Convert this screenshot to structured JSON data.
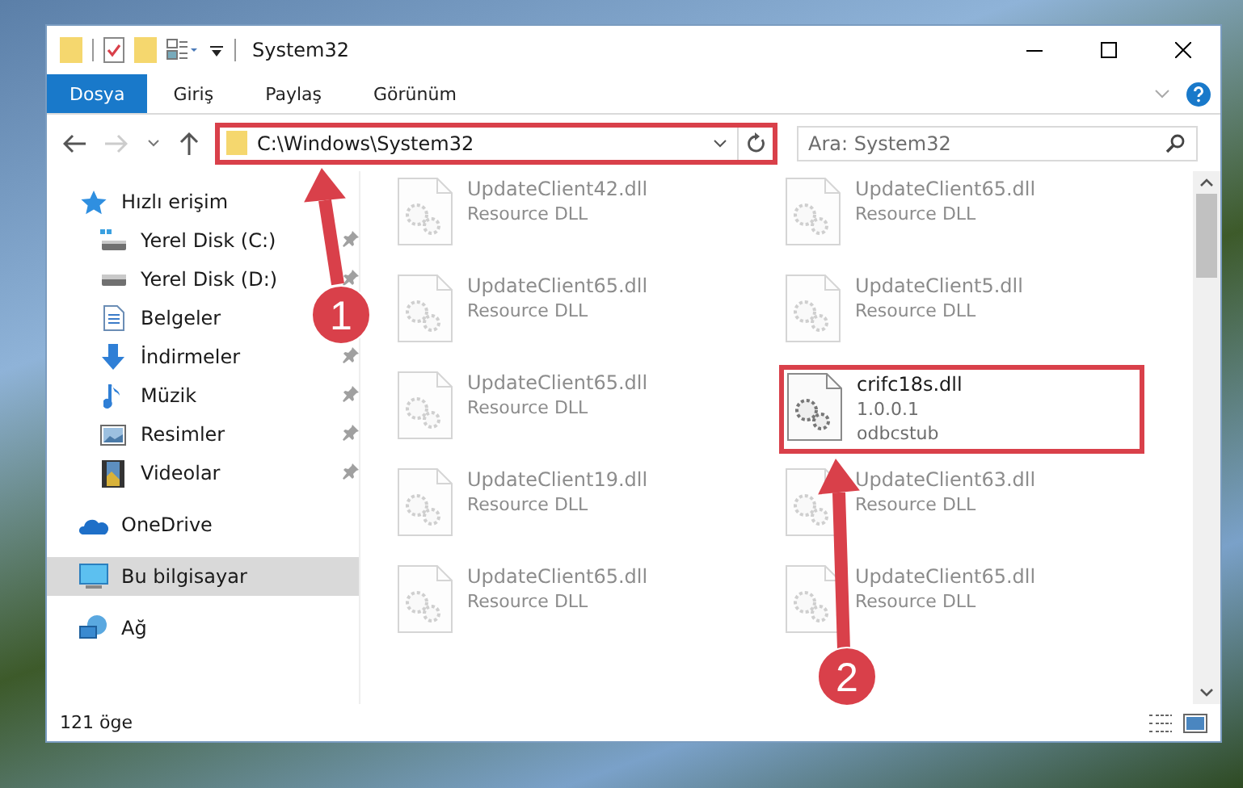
{
  "window": {
    "title": "System32"
  },
  "ribbon_tabs": [
    {
      "label": "Dosya",
      "selected": true
    },
    {
      "label": "Giriş",
      "selected": false
    },
    {
      "label": "Paylaş",
      "selected": false
    },
    {
      "label": "Görünüm",
      "selected": false
    }
  ],
  "address": {
    "path": "C:\\Windows\\System32",
    "highlighted": true
  },
  "search": {
    "placeholder": "Ara: System32"
  },
  "nav": [
    {
      "label": "Hızlı erişim",
      "selected": false,
      "children": [
        {
          "label": "Yerel Disk (C:)",
          "selected": false,
          "pinned": true
        },
        {
          "label": "Yerel Disk (D:)",
          "selected": false,
          "pinned": true
        },
        {
          "label": "Belgeler",
          "selected": false
        },
        {
          "label": "İndirmeler",
          "selected": false,
          "pinned": true
        },
        {
          "label": "Müzik",
          "selected": false,
          "pinned": true
        },
        {
          "label": "Resimler",
          "selected": false,
          "pinned": true
        },
        {
          "label": "Videolar",
          "selected": false,
          "pinned": true
        }
      ]
    },
    {
      "label": "OneDrive",
      "selected": false
    },
    {
      "label": "Bu bilgisayar",
      "selected": true
    },
    {
      "label": "Ağ",
      "selected": false
    }
  ],
  "files": [
    {
      "name": "UpdateClient42.dll",
      "lines": [
        "Resource DLL"
      ],
      "faded": true,
      "highlighted": false
    },
    {
      "name": "UpdateClient65.dll",
      "lines": [
        "Resource DLL"
      ],
      "faded": true,
      "highlighted": false
    },
    {
      "name": "UpdateClient65.dll",
      "lines": [
        "Resource DLL"
      ],
      "faded": true,
      "highlighted": false
    },
    {
      "name": "UpdateClient5.dll",
      "lines": [
        "Resource DLL"
      ],
      "faded": true,
      "highlighted": false
    },
    {
      "name": "UpdateClient65.dll",
      "lines": [
        "Resource DLL"
      ],
      "faded": true,
      "highlighted": false
    },
    {
      "name": "crifc18s.dll",
      "lines": [
        "1.0.0.1",
        "odbcstub"
      ],
      "faded": false,
      "highlighted": true
    },
    {
      "name": "UpdateClient19.dll",
      "lines": [
        "Resource DLL"
      ],
      "faded": true,
      "highlighted": false
    },
    {
      "name": "UpdateClient63.dll",
      "lines": [
        "Resource DLL"
      ],
      "faded": true,
      "highlighted": false
    },
    {
      "name": "UpdateClient65.dll",
      "lines": [
        "Resource DLL"
      ],
      "faded": true,
      "highlighted": false
    },
    {
      "name": "UpdateClient65.dll",
      "lines": [
        "Resource DLL"
      ],
      "faded": true,
      "highlighted": false
    }
  ],
  "status_bar": {
    "count": "121 öge"
  },
  "annotations": [
    {
      "number": "1"
    },
    {
      "number": "2"
    }
  ]
}
